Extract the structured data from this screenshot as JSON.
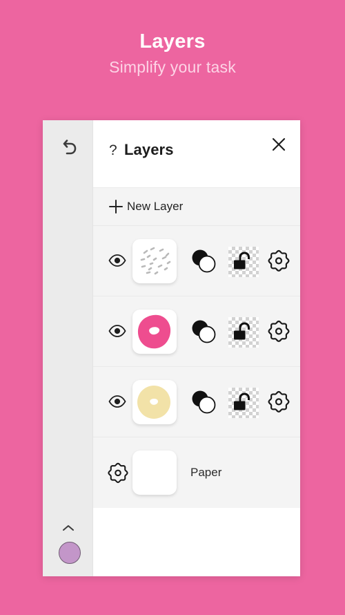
{
  "promo": {
    "title": "Layers",
    "subtitle": "Simplify your task"
  },
  "colors": {
    "background": "#ed65a0",
    "panel": "#ffffff",
    "row": "#f4f4f4",
    "frosting": "#ee4d8f",
    "dough": "#f2e2a8",
    "swatch": "#c396c9"
  },
  "toolbar": {
    "undo_icon": "undo-arrow-icon",
    "collapse_icon": "chevron-up-icon",
    "color_swatch": "#c396c9"
  },
  "panel": {
    "help_glyph": "?",
    "title": "Layers",
    "close_icon": "close-x-icon",
    "new_layer": {
      "plus_icon": "plus-icon",
      "label": "New Layer"
    },
    "layers": [
      {
        "name": "sprinkles-layer",
        "visible_icon": "eye-icon",
        "thumbnail": "sprinkles-thumbnail",
        "blend_icon": "blend-mode-icon",
        "lock_icon": "unlocked-padlock-icon",
        "settings_icon": "gear-icon"
      },
      {
        "name": "frosting-layer",
        "visible_icon": "eye-icon",
        "thumbnail": "pink-donut-thumbnail",
        "blend_icon": "blend-mode-icon",
        "lock_icon": "unlocked-padlock-icon",
        "settings_icon": "gear-icon"
      },
      {
        "name": "dough-layer",
        "visible_icon": "eye-icon",
        "thumbnail": "cream-donut-thumbnail",
        "blend_icon": "blend-mode-icon",
        "lock_icon": "unlocked-padlock-icon",
        "settings_icon": "gear-icon"
      }
    ],
    "paper_row": {
      "settings_icon": "gear-icon",
      "thumbnail": "white-paper-thumbnail",
      "label": "Paper"
    }
  }
}
